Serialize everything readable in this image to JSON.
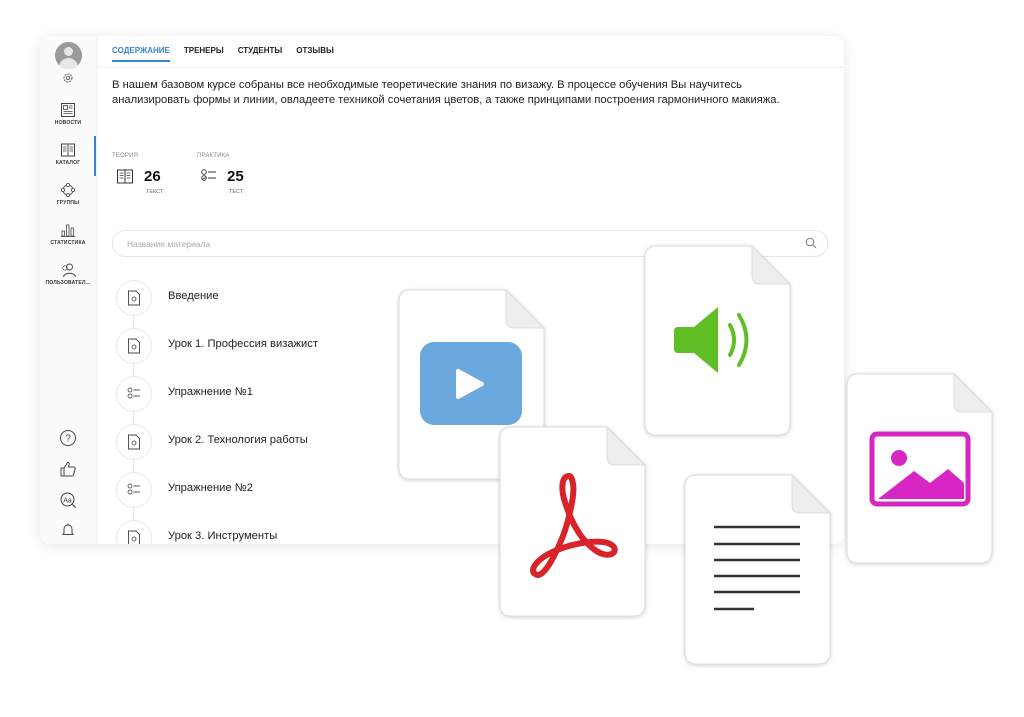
{
  "sidebar": {
    "items": [
      {
        "label": "НОВОСТИ",
        "icon": "newspaper-icon"
      },
      {
        "label": "КАТАЛОГ",
        "icon": "catalog-book-icon"
      },
      {
        "label": "ГРУППЫ",
        "icon": "groups-icon"
      },
      {
        "label": "СТАТИСТИКА",
        "icon": "bar-chart-icon"
      },
      {
        "label": "ПОЛЬЗОВАТЕЛ...",
        "icon": "users-icon"
      }
    ],
    "active": "КАТАЛОГ",
    "bottom_icons": [
      "help-icon",
      "thumbs-up-icon",
      "language-icon",
      "bell-icon"
    ]
  },
  "tabs": [
    {
      "label": "СОДЕРЖАНИЕ",
      "active": true
    },
    {
      "label": "ТРЕНЕРЫ",
      "active": false
    },
    {
      "label": "СТУДЕНТЫ",
      "active": false
    },
    {
      "label": "ОТЗЫВЫ",
      "active": false
    }
  ],
  "intro": "В нашем базовом курсе собраны все необходимые теоретические знания по визажу. В процессе обучения Вы научитесь анализировать формы и линии, овладеете техникой сочетания цветов, а также принципами построения гармоничного макияжа.",
  "stats": {
    "theory": {
      "label": "ТЕОРИЯ",
      "count": "26",
      "unit": "ТЕКСТ"
    },
    "practice": {
      "label": "ПРАКТИКА",
      "count": "25",
      "unit": "ТЕСТ"
    }
  },
  "search": {
    "placeholder": "Название материала",
    "value": ""
  },
  "lessons": [
    {
      "title": "Введение",
      "kind": "text"
    },
    {
      "title": "Урок 1. Профессия визажист",
      "kind": "text"
    },
    {
      "title": "Упражнение №1",
      "kind": "test"
    },
    {
      "title": "Урок 2. Технология работы",
      "kind": "text"
    },
    {
      "title": "Упражнение №2",
      "kind": "test"
    },
    {
      "title": "Урок 3. Инструменты",
      "kind": "text"
    }
  ],
  "colors": {
    "accent": "#3a83d4",
    "video": "#6aa8de",
    "audio": "#5fbf25",
    "pdf": "#d8232a",
    "image": "#d726c4"
  }
}
